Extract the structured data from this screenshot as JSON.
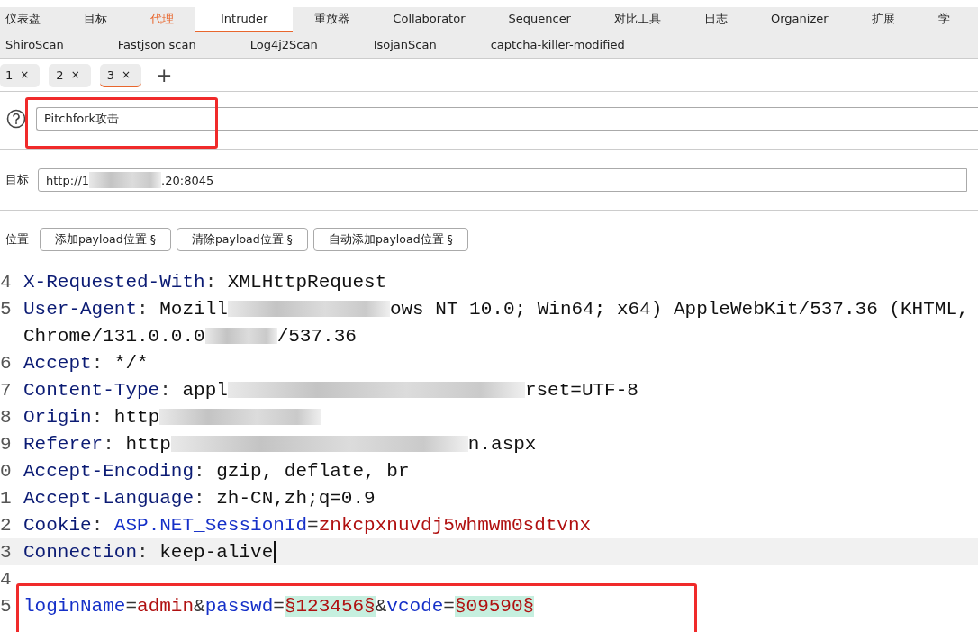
{
  "main_tabs": [
    {
      "label": "仪表盘",
      "selected": false,
      "highlighted": false
    },
    {
      "label": "目标",
      "selected": false,
      "highlighted": false
    },
    {
      "label": "代理",
      "selected": false,
      "highlighted": true
    },
    {
      "label": "Intruder",
      "selected": true,
      "highlighted": false
    },
    {
      "label": "重放器",
      "selected": false,
      "highlighted": false
    },
    {
      "label": "Collaborator",
      "selected": false,
      "highlighted": false
    },
    {
      "label": "Sequencer",
      "selected": false,
      "highlighted": false
    },
    {
      "label": "对比工具",
      "selected": false,
      "highlighted": false
    },
    {
      "label": "日志",
      "selected": false,
      "highlighted": false
    },
    {
      "label": "Organizer",
      "selected": false,
      "highlighted": false
    },
    {
      "label": "扩展",
      "selected": false,
      "highlighted": false
    },
    {
      "label": "学",
      "selected": false,
      "highlighted": false
    }
  ],
  "extension_tabs": [
    "ShiroScan",
    "Fastjson scan",
    "Log4j2Scan",
    "TsojanScan",
    "captcha-killer-modified"
  ],
  "attack_tabs": [
    {
      "label": "1",
      "close": "×",
      "selected": false
    },
    {
      "label": "2",
      "close": "×",
      "selected": false
    },
    {
      "label": "3",
      "close": "×",
      "selected": true
    }
  ],
  "add_tab": "+",
  "attack_type": {
    "value": "Pitchfork攻击"
  },
  "target": {
    "label": "目标",
    "parts": [
      {
        "kind": "text",
        "text": "http://1"
      },
      {
        "kind": "redaction"
      },
      {
        "kind": "text",
        "text": ".20:8045"
      }
    ]
  },
  "positions": {
    "label": "位置",
    "buttons": [
      "添加payload位置 §",
      "清除payload位置 §",
      "自动添加payload位置 §"
    ]
  },
  "editor_lines": [
    {
      "number": "4",
      "current": false,
      "tokens": [
        {
          "kind": "key",
          "text": "X-Requested-With"
        },
        {
          "kind": "punct",
          "text": ": "
        },
        {
          "kind": "value",
          "text": "XMLHttpRequest"
        }
      ]
    },
    {
      "number": "5",
      "current": false,
      "tokens": [
        {
          "kind": "key",
          "text": "User-Agent"
        },
        {
          "kind": "punct",
          "text": ": "
        },
        {
          "kind": "value",
          "text": "Mozill"
        },
        {
          "kind": "wideredaction"
        },
        {
          "kind": "value",
          "text": "ows NT 10.0; Win64; x64) AppleWebKit/537.36 (KHTML,"
        }
      ]
    },
    {
      "current": false,
      "tokens": [
        {
          "kind": "value",
          "text": "Chrome/131.0.0.0"
        },
        {
          "kind": "redaction"
        },
        {
          "kind": "value",
          "text": "/537.36"
        }
      ]
    },
    {
      "number": "6",
      "current": false,
      "tokens": [
        {
          "kind": "key",
          "text": "Accept"
        },
        {
          "kind": "punct",
          "text": ": "
        },
        {
          "kind": "value",
          "text": "*/*"
        }
      ]
    },
    {
      "number": "7",
      "current": false,
      "tokens": [
        {
          "kind": "key",
          "text": "Content-Type"
        },
        {
          "kind": "punct",
          "text": ": "
        },
        {
          "kind": "value",
          "text": "appl"
        },
        {
          "kind": "longredaction"
        },
        {
          "kind": "value",
          "text": "rset=UTF-8"
        }
      ]
    },
    {
      "number": "8",
      "current": false,
      "tokens": [
        {
          "kind": "key",
          "text": "Origin"
        },
        {
          "kind": "punct",
          "text": ": "
        },
        {
          "kind": "value",
          "text": "http"
        },
        {
          "kind": "wideredaction"
        }
      ]
    },
    {
      "number": "9",
      "current": false,
      "tokens": [
        {
          "kind": "key",
          "text": "Referer"
        },
        {
          "kind": "punct",
          "text": ": "
        },
        {
          "kind": "value",
          "text": "http"
        },
        {
          "kind": "longredaction"
        },
        {
          "kind": "value",
          "text": "n.aspx"
        }
      ]
    },
    {
      "number": "0",
      "current": false,
      "tokens": [
        {
          "kind": "key",
          "text": "Accept-Encoding"
        },
        {
          "kind": "punct",
          "text": ": "
        },
        {
          "kind": "value",
          "text": "gzip, deflate, br"
        }
      ]
    },
    {
      "number": "1",
      "current": false,
      "tokens": [
        {
          "kind": "key",
          "text": "Accept-Language"
        },
        {
          "kind": "punct",
          "text": ": "
        },
        {
          "kind": "value",
          "text": "zh-CN,zh;q=0.9"
        }
      ]
    },
    {
      "number": "2",
      "current": false,
      "tokens": [
        {
          "kind": "key",
          "text": "Cookie"
        },
        {
          "kind": "punct",
          "text": ": "
        },
        {
          "kind": "param",
          "text": "ASP.NET_SessionId"
        },
        {
          "kind": "punct",
          "text": "="
        },
        {
          "kind": "pvalue",
          "text": "znkcpxnuvdj5whmwm0sdtvnx"
        }
      ]
    },
    {
      "number": "3",
      "current": true,
      "tokens": [
        {
          "kind": "key",
          "text": "Connection"
        },
        {
          "kind": "punct",
          "text": ": "
        },
        {
          "kind": "value",
          "text": "keep-alive"
        }
      ]
    },
    {
      "number": "4",
      "current": false
    },
    {
      "number": "5",
      "current": false,
      "tokens": [
        {
          "kind": "param",
          "text": "loginName"
        },
        {
          "kind": "punct",
          "text": "="
        },
        {
          "kind": "pvalue",
          "text": "admin"
        },
        {
          "kind": "punct",
          "text": "&"
        },
        {
          "kind": "param",
          "text": "passwd"
        },
        {
          "kind": "punct",
          "text": "="
        },
        {
          "kind": "payload",
          "text": "§123456§"
        },
        {
          "kind": "punct",
          "text": "&"
        },
        {
          "kind": "param",
          "text": "vcode"
        },
        {
          "kind": "punct",
          "text": "="
        },
        {
          "kind": "payload",
          "text": "§09590§"
        }
      ]
    }
  ]
}
